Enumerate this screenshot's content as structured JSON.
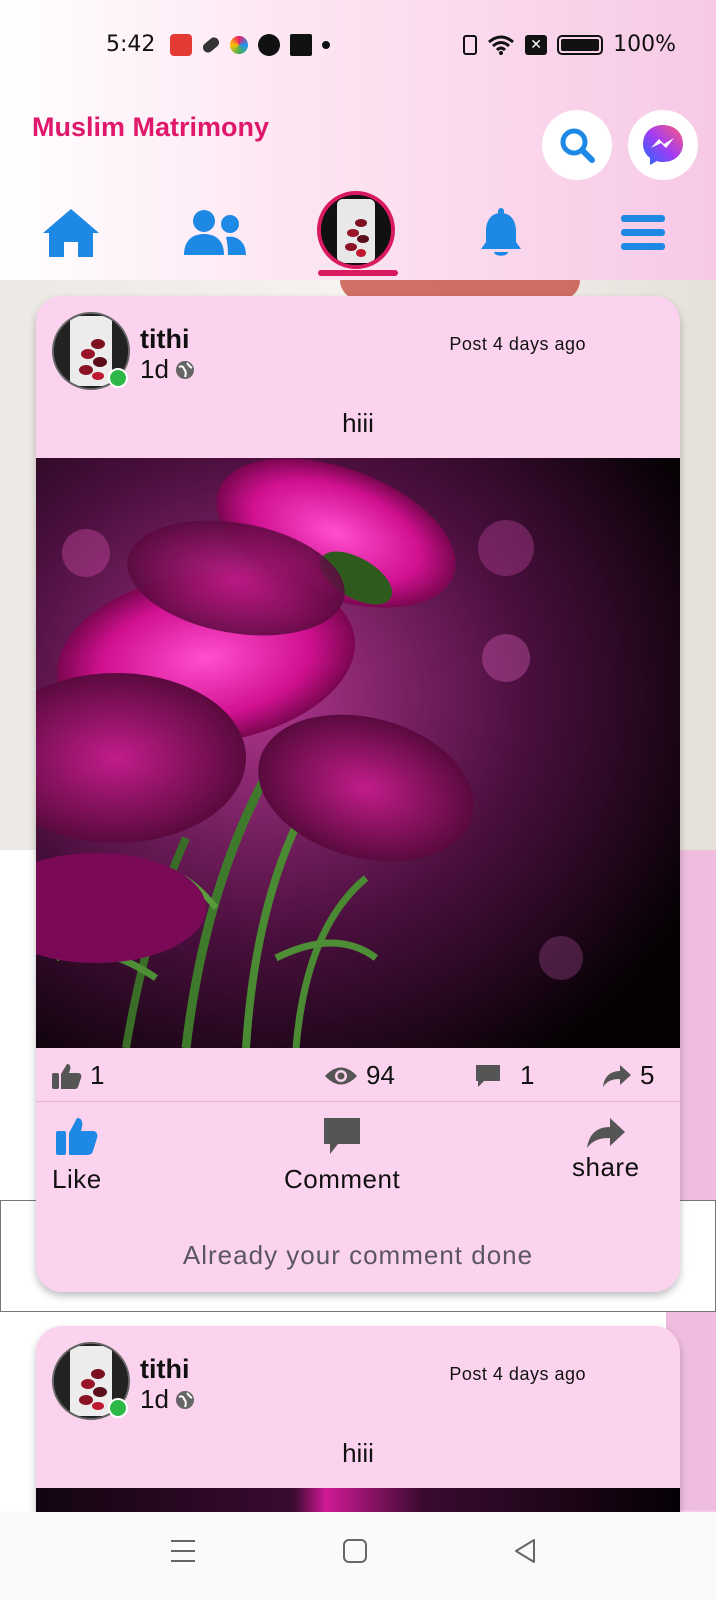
{
  "status_bar": {
    "time": "5:42",
    "battery": "100%"
  },
  "header": {
    "title": "Muslim Matrimony",
    "search_icon": "search-icon",
    "messenger_icon": "messenger-icon"
  },
  "nav": {
    "items": [
      "home-icon",
      "friends-icon",
      "profile-avatar",
      "bell-icon",
      "menu-icon"
    ]
  },
  "posts": [
    {
      "user": "tithi",
      "age": "1d",
      "posted": "Post 4 days ago",
      "text": "hiii",
      "likes": "1",
      "views": "94",
      "comments": "1",
      "shares": "5",
      "like_label": "Like",
      "comment_label": "Comment",
      "share_label": "share",
      "comment_status": "Already your comment done"
    },
    {
      "user": "tithi",
      "age": "1d",
      "posted": "Post 4 days ago",
      "text": "hiii"
    }
  ],
  "colors": {
    "brand": "#e0186c",
    "nav_blue": "#1e88e5",
    "card_bg": "#fcd3ee",
    "online": "#2eb84a"
  }
}
